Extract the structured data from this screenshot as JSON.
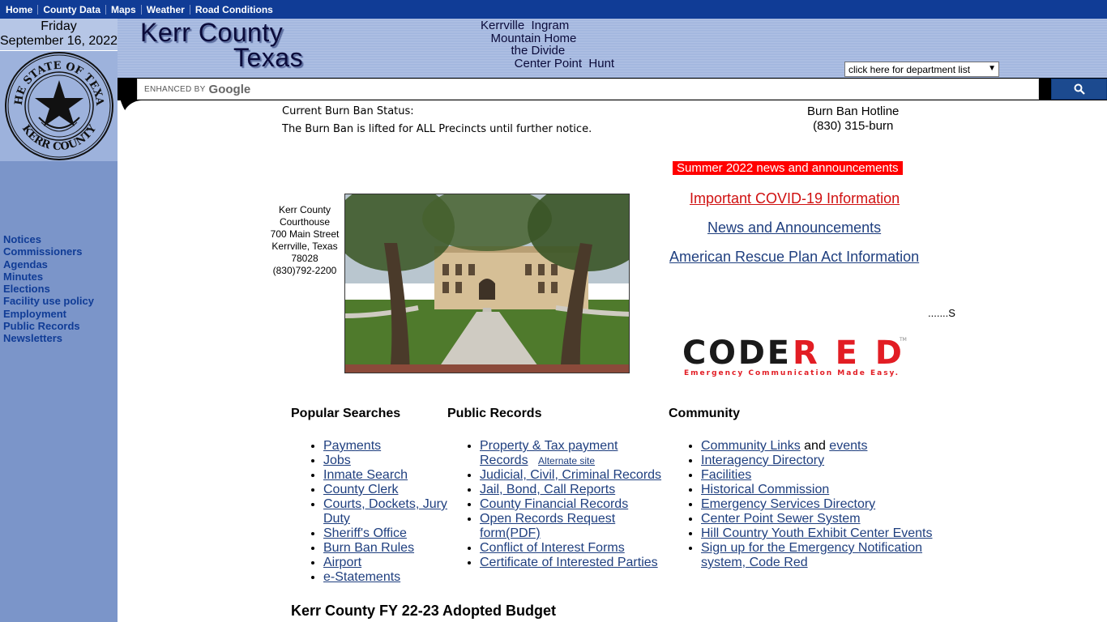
{
  "topnav": {
    "items": [
      "Home",
      "County Data",
      "Maps",
      "Weather",
      "Road Conditions"
    ]
  },
  "date": {
    "weekday": "Friday",
    "full": "September 16, 2022"
  },
  "seal": {
    "top_text": "THE STATE OF TEXAS",
    "bottom_text": "KERR COUNTY"
  },
  "header": {
    "title_line1": "Kerr County",
    "title_line2": "Texas",
    "towns": [
      "Kerrville  Ingram",
      "   Mountain Home",
      "         the Divide",
      "          Center Point  Hunt"
    ],
    "dept_select": "click here for department list"
  },
  "search": {
    "enhanced_by": "ENHANCED BY",
    "brand": "Google",
    "button_icon": "search-icon"
  },
  "burn_ban": {
    "status_label": "Current Burn Ban Status:",
    "status_text": "The Burn Ban is lifted for ALL Precincts until further notice.",
    "hotline_label": "Burn Ban Hotline",
    "hotline_number": "(830) 315-burn"
  },
  "sidebar": {
    "links": [
      "Notices",
      "Commissioners",
      "Agendas",
      "Minutes",
      "Elections",
      "Facility use policy",
      "Employment",
      "Public Records",
      "Newsletters"
    ]
  },
  "courthouse": {
    "lines": [
      "Kerr County",
      "Courthouse",
      "700 Main Street",
      "Kerrville, Texas",
      "78028",
      "(830)792-2200"
    ]
  },
  "announcements": {
    "summer": "Summer 2022 news and announcements",
    "covid": "Important COVID-19 Information",
    "news": "News and Announcements",
    "arpa": "American Rescue Plan Act Information",
    "dots": ".......S"
  },
  "codered": {
    "word1": "CODE",
    "word2": "RED",
    "tagline": "Emergency Communication Made Easy.",
    "tm": "TM"
  },
  "columns": {
    "popular": {
      "title": "Popular Searches",
      "items": [
        "Payments",
        "Jobs",
        "Inmate Search",
        "County Clerk",
        "Courts, Dockets, Jury Duty",
        "Sheriff's Office",
        "Burn Ban Rules",
        "Airport",
        "e-Statements"
      ]
    },
    "records": {
      "title": "Public Records",
      "item0": "Property & Tax payment Records",
      "item0_alt": "Alternate site",
      "items": [
        "Judicial, Civil, Criminal Records",
        "Jail, Bond, Call Reports",
        "County Financial Records",
        "Open Records Request form(PDF)",
        "Conflict of Interest Forms",
        "Certificate of Interested Parties"
      ]
    },
    "community": {
      "title": "Community",
      "item0_a": "Community Links",
      "item0_and": " and ",
      "item0_b": "events",
      "items": [
        "Interagency Directory",
        "Facilities",
        "Historical Commission",
        "Emergency Services Directory",
        "Center Point Sewer System",
        "Hill Country Youth Exhibit Center Events",
        "Sign up for the Emergency Notification system, Code Red"
      ]
    }
  },
  "budget_title": "Kerr County FY 22-23 Adopted Budget"
}
